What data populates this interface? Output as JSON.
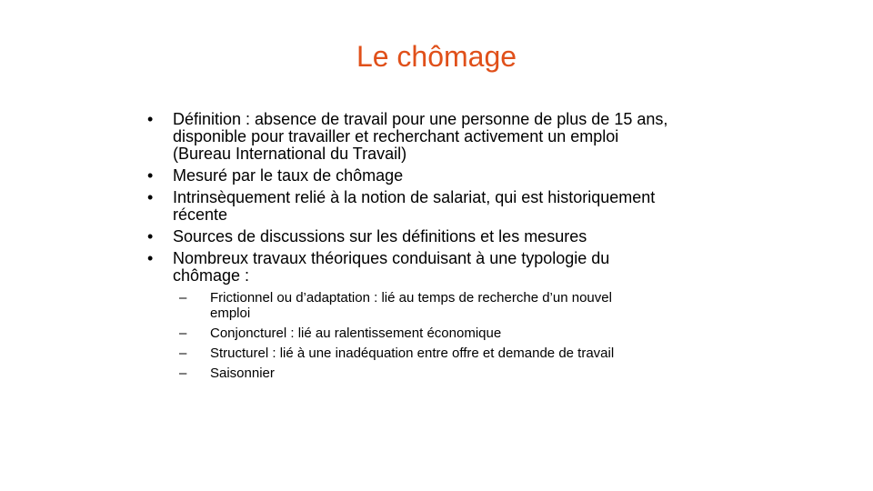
{
  "slide": {
    "title": "Le chômage",
    "title_color": "#e0501a",
    "bullets": [
      {
        "marker": "•",
        "lines": [
          "Définition  : absence de travail pour une personne de plus de 15 ans,",
          "disponible  pour travailler et recherchant  activement  un emploi",
          "(Bureau  International  du Travail)"
        ]
      },
      {
        "marker": "•",
        "lines": [
          "Mesuré par le taux de chômage"
        ]
      },
      {
        "marker": "•",
        "lines": [
          "Intrinsèquement  relié à la notion de salariat, qui est historiquement",
          "récente"
        ]
      },
      {
        "marker": "•",
        "lines": [
          "Sources de discussions  sur les définitions  et les mesures"
        ]
      },
      {
        "marker": "•",
        "lines": [
          "Nombreux  travaux théoriques  conduisant  à une typologie du",
          "chômage  :"
        ]
      }
    ],
    "sub_bullets": [
      {
        "marker": "–",
        "lines": [
          "Frictionnel ou d’adaptation : lié au temps de recherche d’un nouvel",
          "emploi"
        ]
      },
      {
        "marker": "–",
        "lines": [
          "Conjoncturel : lié au ralentissement économique"
        ]
      },
      {
        "marker": "–",
        "lines": [
          "Structurel : lié à une inadéquation entre offre et demande de travail"
        ]
      },
      {
        "marker": "–",
        "lines": [
          "Saisonnier"
        ]
      }
    ]
  }
}
